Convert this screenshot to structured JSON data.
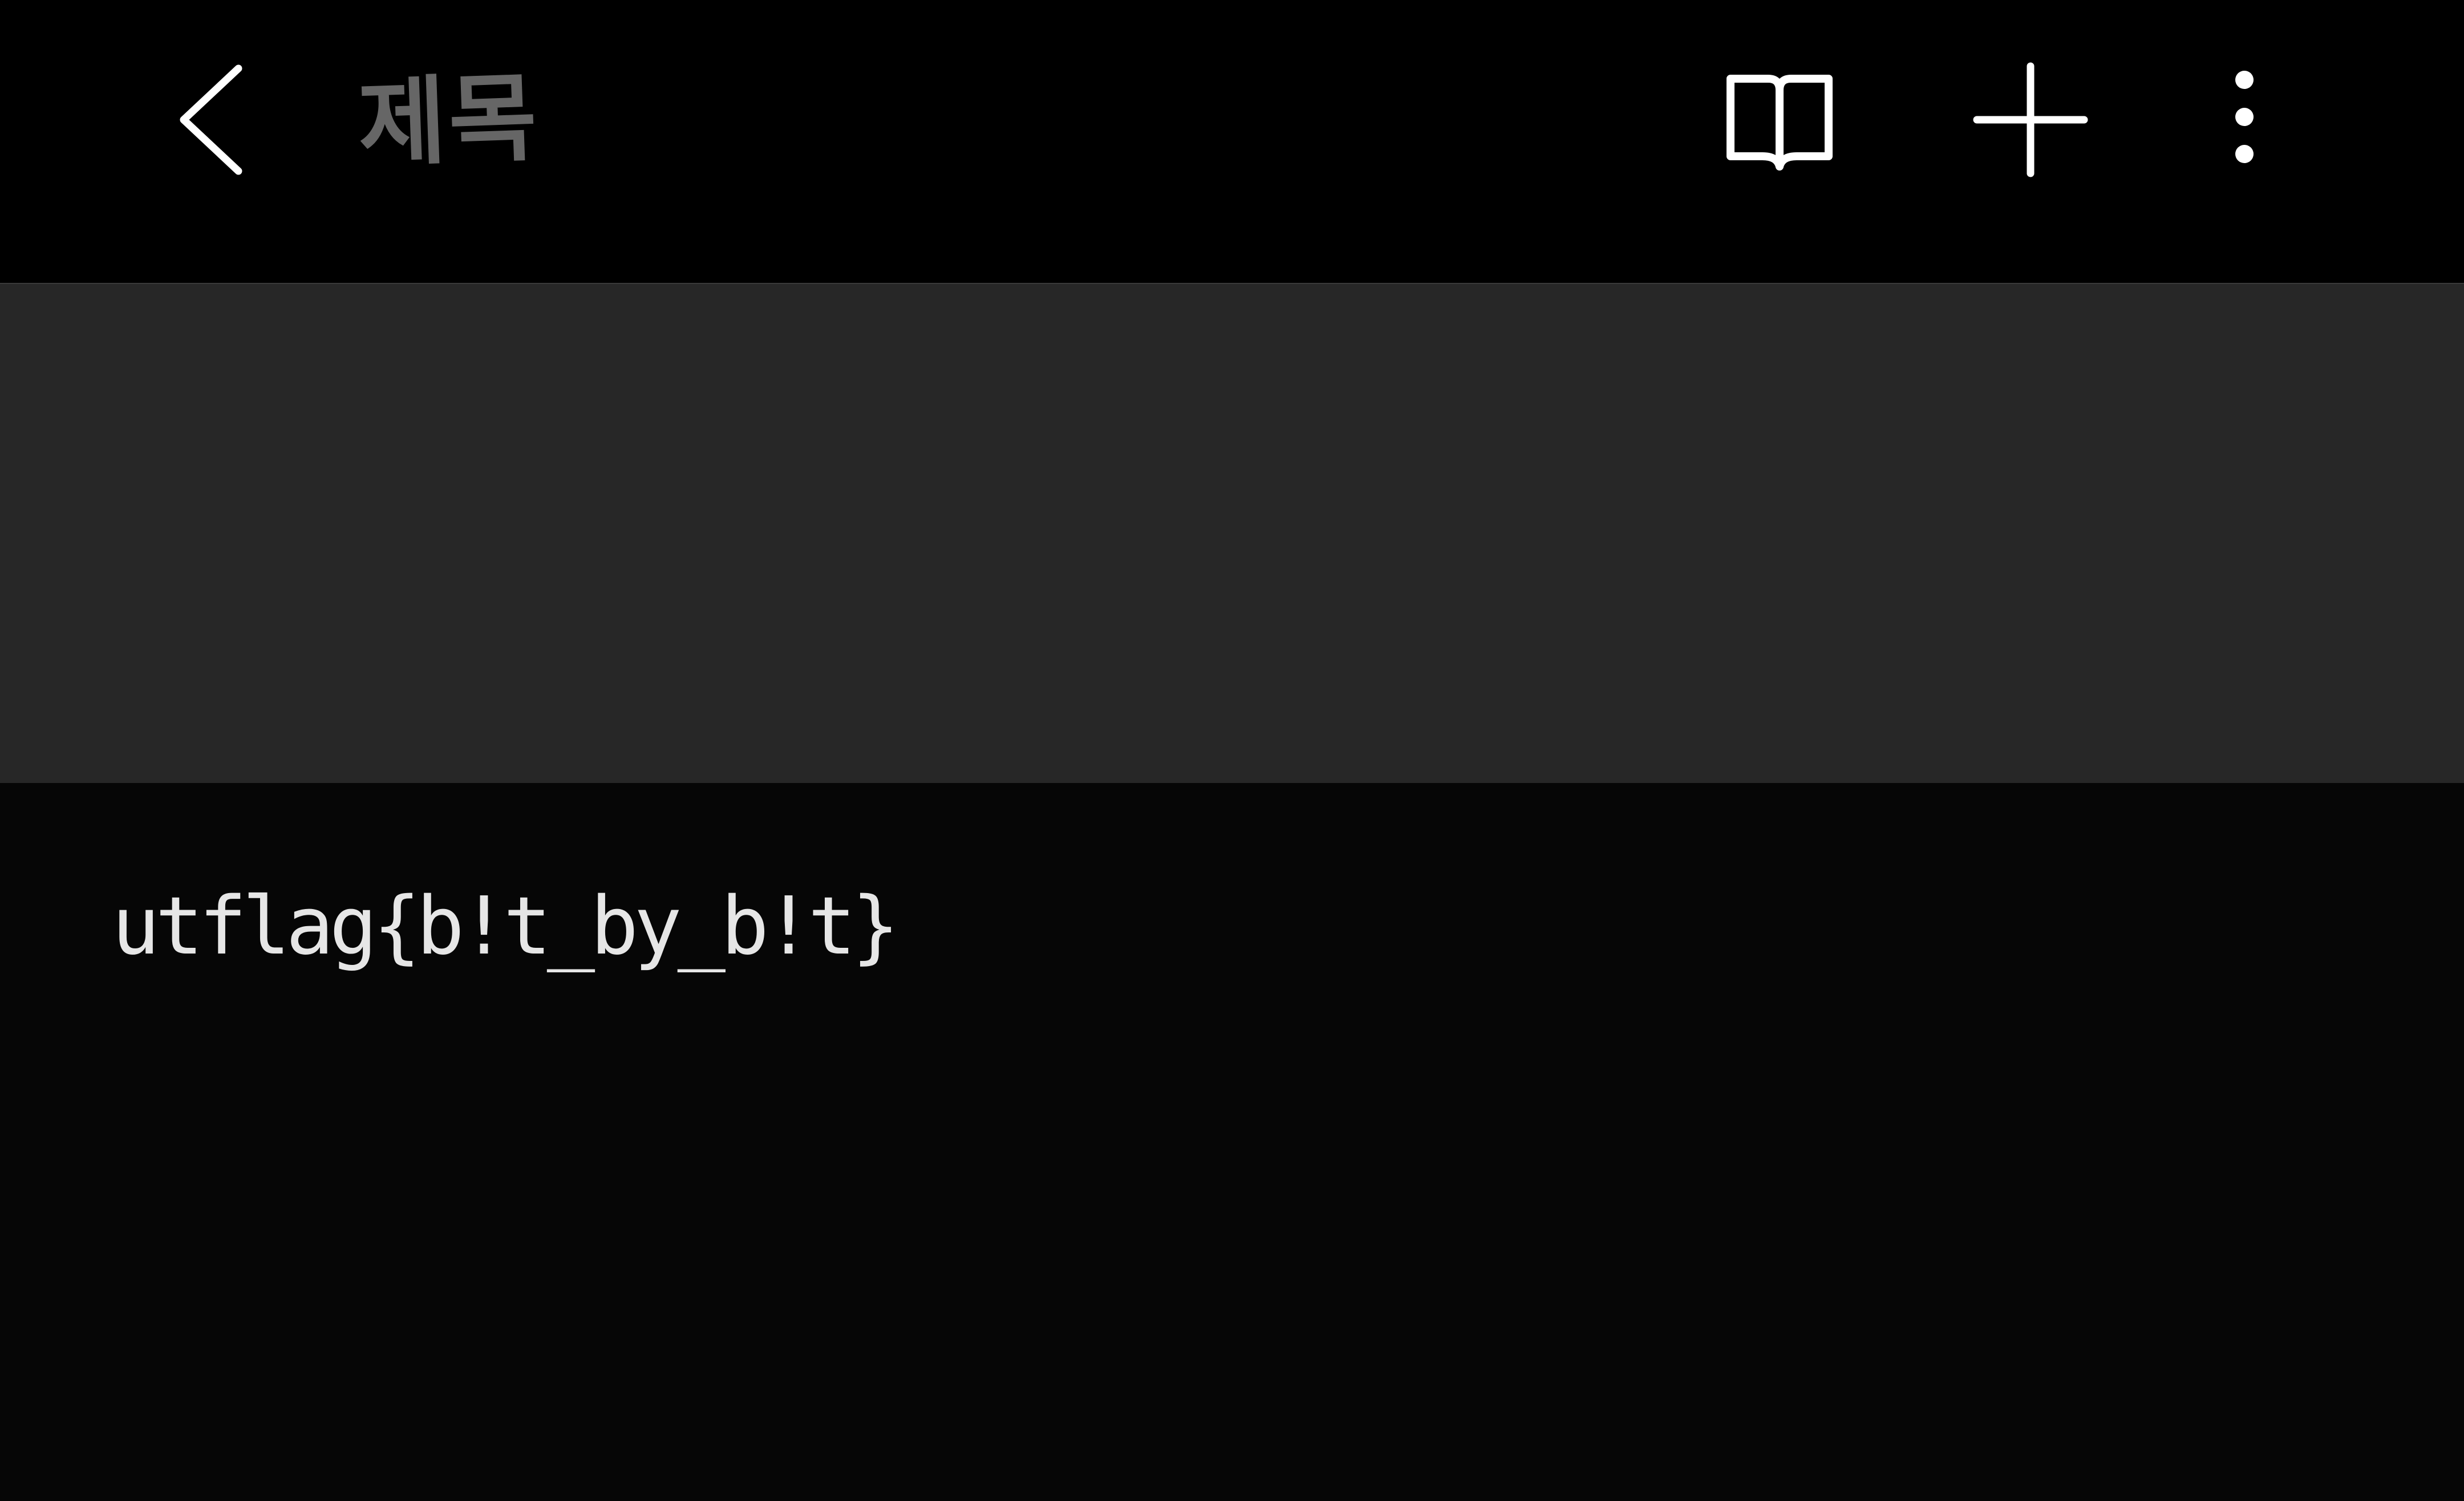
{
  "header": {
    "title": "제목",
    "back_icon": "chevron-left-icon",
    "reader_icon": "open-book-icon",
    "add_icon": "plus-icon",
    "more_icon": "more-vertical-icon"
  },
  "note": {
    "text": "utflag{b!t_by_b!t}"
  },
  "colors": {
    "header_background": "#000000",
    "banner_background": "#272727",
    "content_background": "#060606",
    "title_color": "#666666",
    "text_color": "#e6e6e6",
    "icon_color": "#ffffff"
  }
}
